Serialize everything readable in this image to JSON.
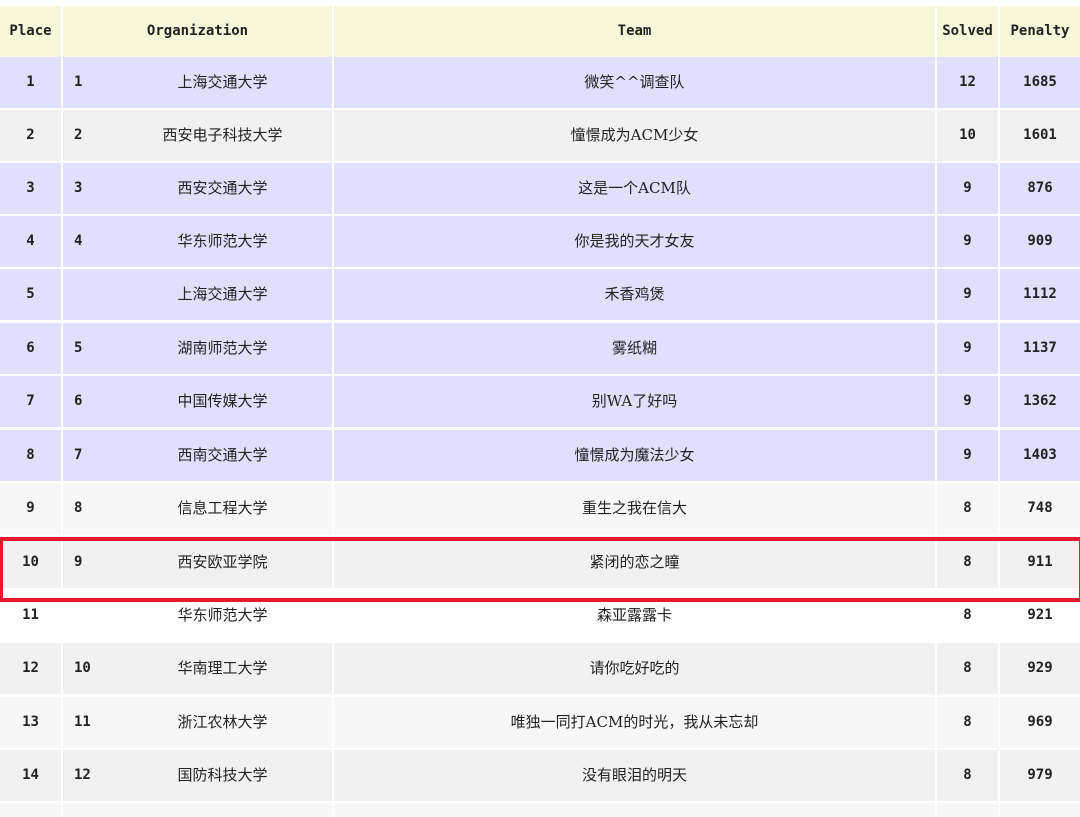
{
  "colors": {
    "header_bg": "#f8f7dc",
    "lavender_row": "#e0e0fd",
    "gray_row": "#f1f1f1",
    "highlight_border": "#e8192c"
  },
  "header": {
    "place": "Place",
    "organization": "Organization",
    "team": "Team",
    "solved": "Solved",
    "penalty": "Penalty"
  },
  "rows": [
    {
      "place": "1",
      "rank": "1",
      "org": "上海交通大学",
      "team": "微笑^^调查队",
      "solved": "12",
      "penalty": "1685"
    },
    {
      "place": "2",
      "rank": "2",
      "org": "西安电子科技大学",
      "team": "憧憬成为ACM少女",
      "solved": "10",
      "penalty": "1601"
    },
    {
      "place": "3",
      "rank": "3",
      "org": "西安交通大学",
      "team": "这是一个ACM队",
      "solved": "9",
      "penalty": "876"
    },
    {
      "place": "4",
      "rank": "4",
      "org": "华东师范大学",
      "team": "你是我的天才女友",
      "solved": "9",
      "penalty": "909"
    },
    {
      "place": "5",
      "rank": "",
      "org": "上海交通大学",
      "team": "禾香鸡煲",
      "solved": "9",
      "penalty": "1112"
    },
    {
      "place": "6",
      "rank": "5",
      "org": "湖南师范大学",
      "team": "雾纸糊",
      "solved": "9",
      "penalty": "1137"
    },
    {
      "place": "7",
      "rank": "6",
      "org": "中国传媒大学",
      "team": "别WA了好吗",
      "solved": "9",
      "penalty": "1362"
    },
    {
      "place": "8",
      "rank": "7",
      "org": "西南交通大学",
      "team": "憧憬成为魔法少女",
      "solved": "9",
      "penalty": "1403"
    },
    {
      "place": "9",
      "rank": "8",
      "org": "信息工程大学",
      "team": "重生之我在信大",
      "solved": "8",
      "penalty": "748"
    },
    {
      "place": "10",
      "rank": "9",
      "org": "西安欧亚学院",
      "team": "紧闭的恋之瞳",
      "solved": "8",
      "penalty": "911"
    },
    {
      "place": "11",
      "rank": "",
      "org": "华东师范大学",
      "team": "森亚露露卡",
      "solved": "8",
      "penalty": "921"
    },
    {
      "place": "12",
      "rank": "10",
      "org": "华南理工大学",
      "team": "请你吃好吃的",
      "solved": "8",
      "penalty": "929"
    },
    {
      "place": "13",
      "rank": "11",
      "org": "浙江农林大学",
      "team": "唯独一同打ACM的时光，我从未忘却",
      "solved": "8",
      "penalty": "969"
    },
    {
      "place": "14",
      "rank": "12",
      "org": "国防科技大学",
      "team": "没有眼泪的明天",
      "solved": "8",
      "penalty": "979"
    }
  ]
}
